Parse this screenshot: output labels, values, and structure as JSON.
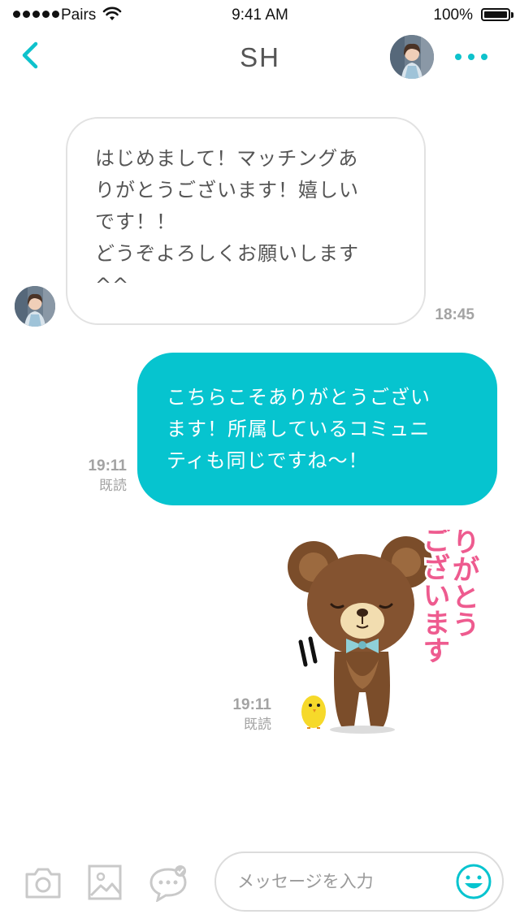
{
  "status_bar": {
    "carrier": "Pairs",
    "time": "9:41 AM",
    "battery": "100%"
  },
  "nav": {
    "title": "SH"
  },
  "messages": [
    {
      "direction": "incoming",
      "lines": [
        "はじめまして！マッチングあ",
        "りがとうございます！嬉しい",
        "です！！",
        "どうぞよろしくお願いします",
        "^^"
      ],
      "time": "18:45"
    },
    {
      "direction": "outgoing",
      "lines": [
        "こちらこそありがとうござい",
        "ます！所属しているコミュニ",
        "ティも同じですね〜！"
      ],
      "time": "19:11",
      "status": "既読"
    },
    {
      "direction": "outgoing",
      "type": "sticker",
      "sticker_text": [
        "ありがとう",
        "ございます"
      ],
      "time": "19:11",
      "status": "既読"
    }
  ],
  "composer": {
    "placeholder": "メッセージを入力"
  },
  "icons": {
    "back": "chevron-left-icon",
    "more": "more-dots-icon",
    "camera": "camera-icon",
    "image": "image-icon",
    "reply": "chat-bubble-icon",
    "emoji": "smiley-icon"
  },
  "colors": {
    "accent": "#06c4cf",
    "sticker_text": "#ee5b8f"
  }
}
